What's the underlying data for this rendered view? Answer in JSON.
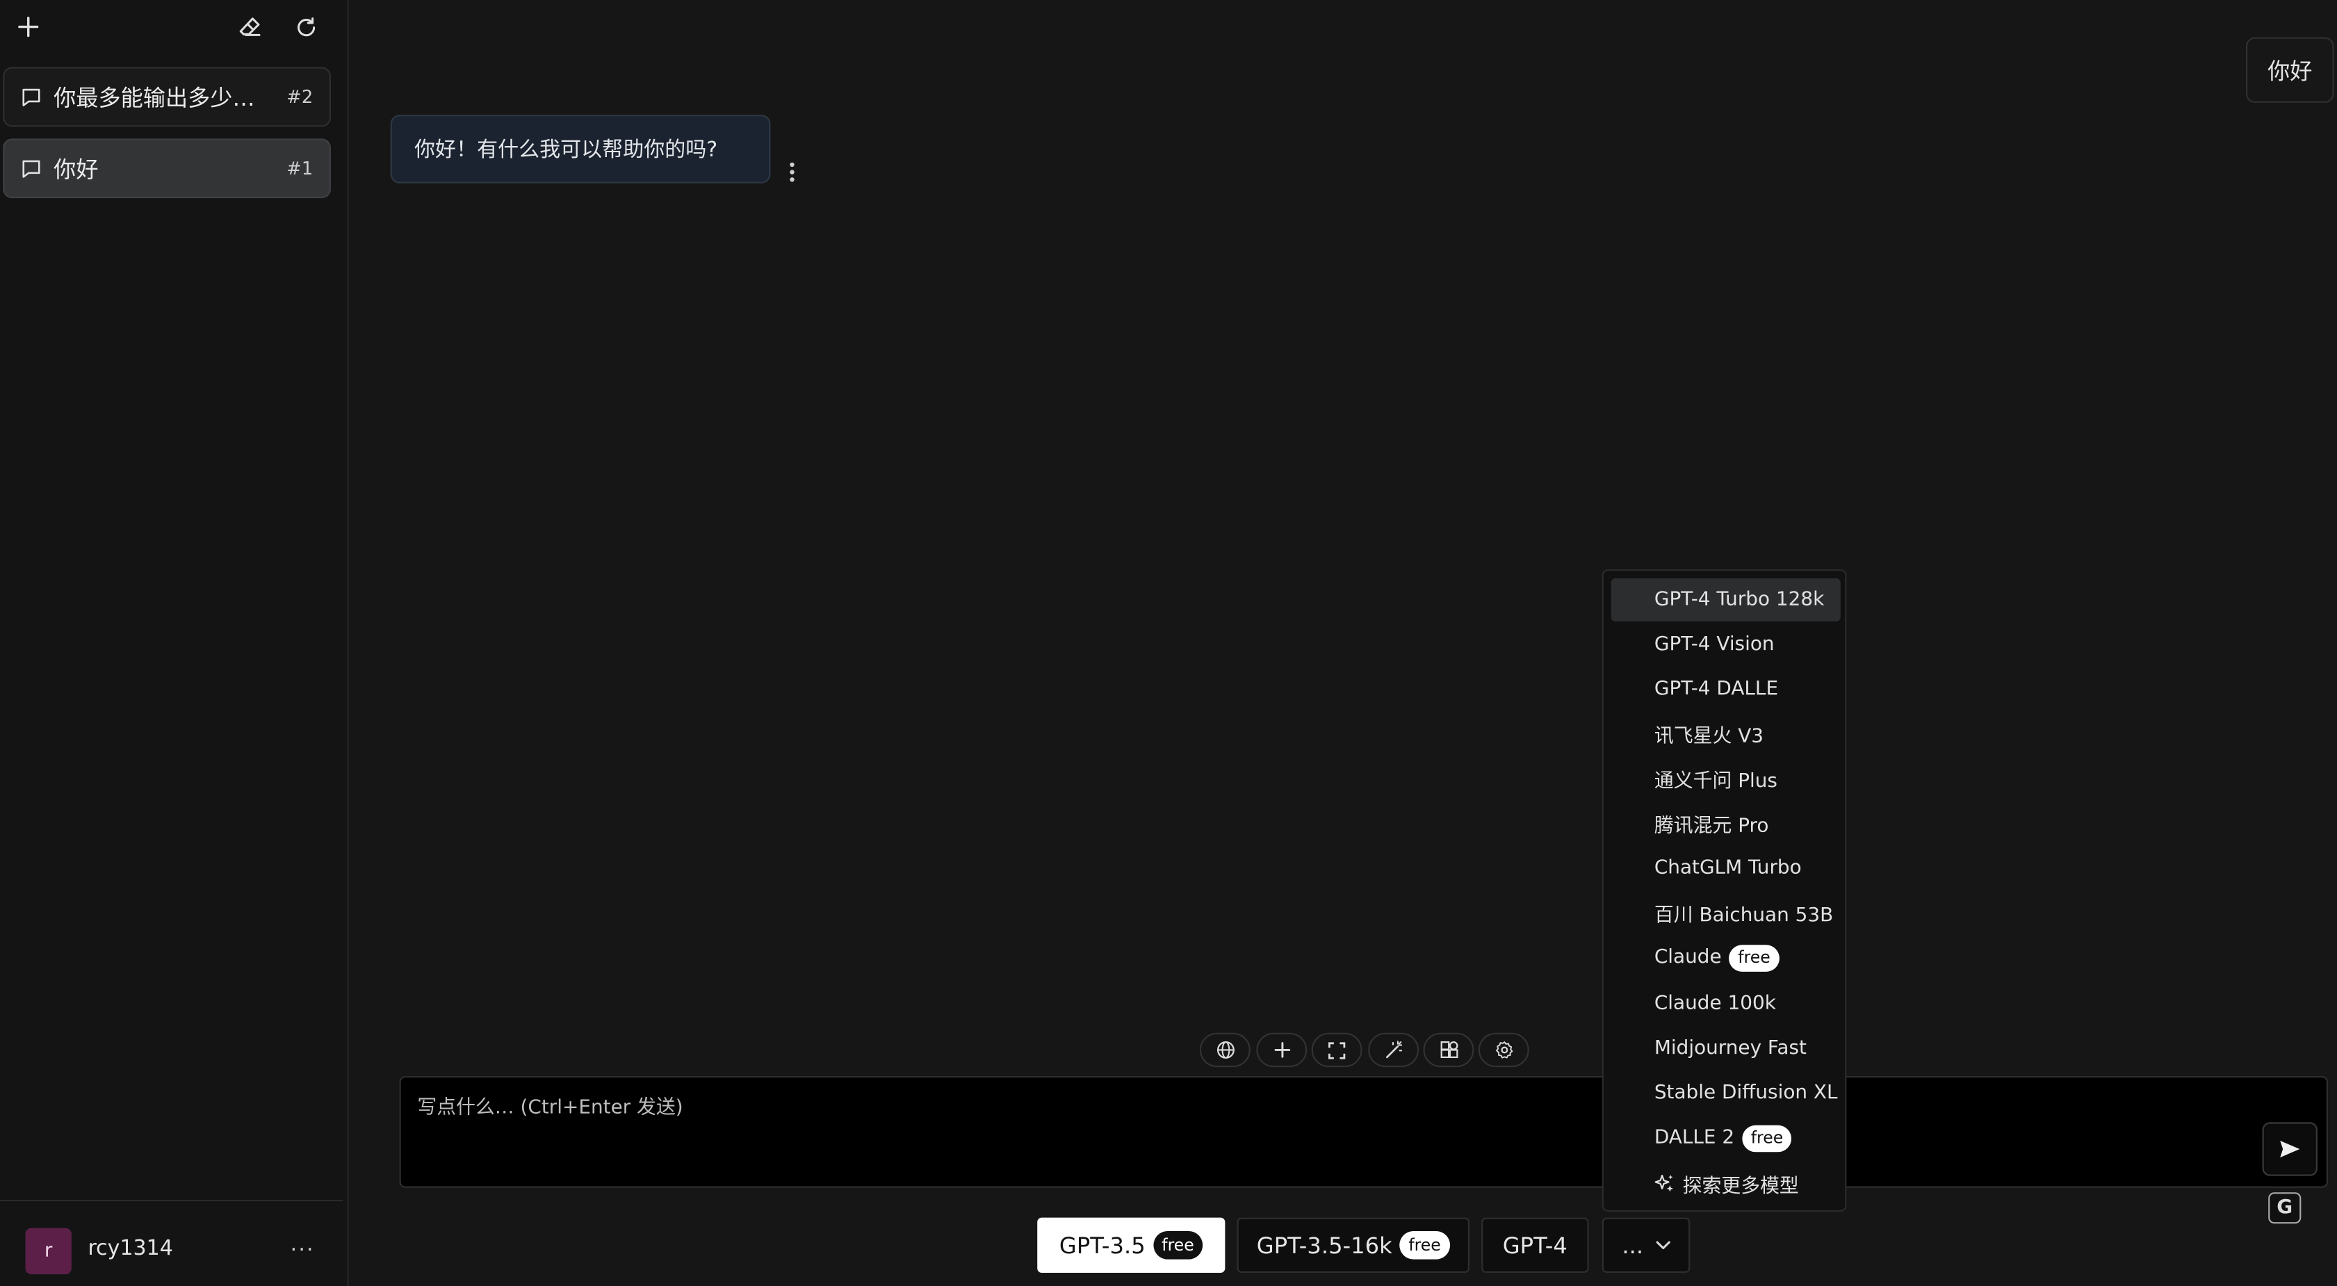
{
  "sidebar": {
    "conversations": [
      {
        "title": "你最多能输出多少个...",
        "num": "#2"
      },
      {
        "title": "你好",
        "num": "#1"
      }
    ],
    "user": {
      "initial": "r",
      "name": "rcy1314"
    },
    "more": "···"
  },
  "chat": {
    "user_message": "你好",
    "bot_message": "你好！有什么我可以帮助你的吗?"
  },
  "input": {
    "placeholder": "写点什么… (Ctrl+Enter 发送)"
  },
  "badge": {
    "label": "G"
  },
  "models": {
    "buttons": [
      {
        "label": "GPT-3.5",
        "badge": "free"
      },
      {
        "label": "GPT-3.5-16k",
        "badge": "free"
      },
      {
        "label": "GPT-4"
      },
      {
        "label": "..."
      }
    ],
    "dropdown": [
      {
        "label": "GPT-4 Turbo 128k"
      },
      {
        "label": "GPT-4 Vision"
      },
      {
        "label": "GPT-4 DALLE"
      },
      {
        "label": "讯飞星火 V3"
      },
      {
        "label": "通义千问 Plus"
      },
      {
        "label": "腾讯混元 Pro"
      },
      {
        "label": "ChatGLM Turbo"
      },
      {
        "label": "百川 Baichuan 53B"
      },
      {
        "label": "Claude",
        "badge": "free"
      },
      {
        "label": "Claude 100k"
      },
      {
        "label": "Midjourney Fast"
      },
      {
        "label": "Stable Diffusion XL"
      },
      {
        "label": "DALLE 2",
        "badge": "free"
      },
      {
        "label": "探索更多模型"
      }
    ]
  },
  "icons": {
    "new_chat": "plus-icon",
    "clear": "eraser-icon",
    "refresh": "refresh-icon",
    "conversation": "chat-bubble-icon",
    "tools": [
      "globe-icon",
      "plus-icon",
      "fullscreen-icon",
      "magic-wand-icon",
      "plugin-icon",
      "settings-icon"
    ],
    "send": "send-icon",
    "explore": "sparkle-icon"
  },
  "colors": {
    "background": "#161616",
    "sidebar": "#141414",
    "bot_bubble": "#1c2330",
    "active_conversation": "#333436",
    "selected_model": "#ffffff"
  }
}
